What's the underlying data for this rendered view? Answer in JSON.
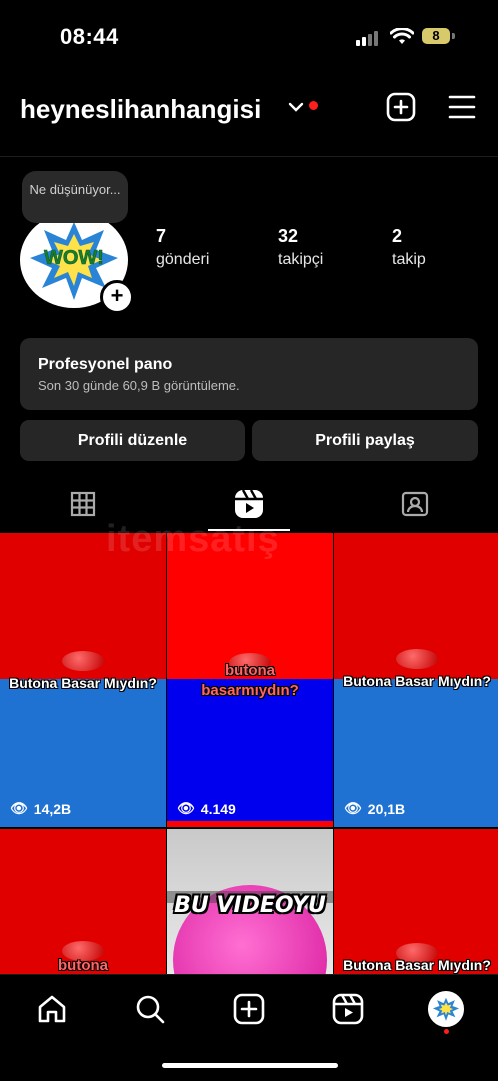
{
  "status_bar": {
    "time": "08:44",
    "battery": "8"
  },
  "header": {
    "username": "heyneslihanhangisi",
    "icons": [
      "chevron-down-icon",
      "add-post-icon",
      "menu-icon"
    ]
  },
  "profile": {
    "note": "Ne düşünüyor...",
    "avatar_text": "WOW!",
    "stats": [
      {
        "value": "7",
        "label": "gönderi"
      },
      {
        "value": "32",
        "label": "takipçi"
      },
      {
        "value": "2",
        "label": "takip"
      }
    ]
  },
  "dashboard": {
    "title": "Profesyonel pano",
    "subtitle": "Son 30 günde 60,9 B görüntüleme."
  },
  "buttons": {
    "edit": "Profili düzenle",
    "share": "Profili paylaş"
  },
  "tabs": [
    "grid-icon",
    "reels-icon",
    "tagged-icon"
  ],
  "watermark": "itemsatış",
  "reels": [
    {
      "caption": "Butona Basar Mıydın?",
      "views": "14,2B"
    },
    {
      "caption": "butona basarmıydın?",
      "views": "4.149"
    },
    {
      "caption": "Butona Basar Mıydın?",
      "views": "20,1B"
    },
    {
      "caption": "butona",
      "views": ""
    },
    {
      "caption": "BU VIDEOYU",
      "views": ""
    },
    {
      "caption": "Butona Basar Mıydın?",
      "views": ""
    }
  ],
  "nav": [
    "home-icon",
    "search-icon",
    "create-icon",
    "reels-nav-icon",
    "profile-avatar"
  ],
  "colors": {
    "accent_red": "#ff1e1e",
    "surface": "#262626",
    "tile_red": "#e00000",
    "tile_blue": "#1e73d8"
  }
}
